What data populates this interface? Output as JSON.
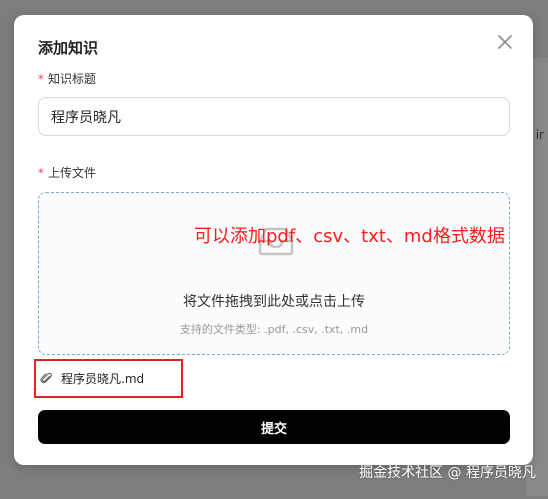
{
  "dialog": {
    "title": "添加知识",
    "close_icon": "close-icon"
  },
  "form": {
    "required_mark": "*",
    "title_field": {
      "label": "知识标题",
      "value": "程序员晓凡"
    },
    "upload_field": {
      "label": "上传文件",
      "icon": "inbox-icon",
      "primary_text": "将文件拖拽到此处或点击上传",
      "hint_text": "支持的文件类型: .pdf, .csv, .txt, .md"
    },
    "uploaded_files": [
      {
        "name": "程序员晓凡.md",
        "icon": "paperclip-icon"
      }
    ],
    "submit_label": "提交"
  },
  "annotation": {
    "text": "可以添加pdf、csv、txt、md格式数据",
    "color": "#ff1a1a"
  },
  "watermark": "掘金技术社区 @ 程序员晓凡",
  "colors": {
    "submit_bg": "#000000",
    "required": "#e5484d",
    "highlight_border": "#e52222",
    "dropzone_border": "#7ea7cf"
  }
}
